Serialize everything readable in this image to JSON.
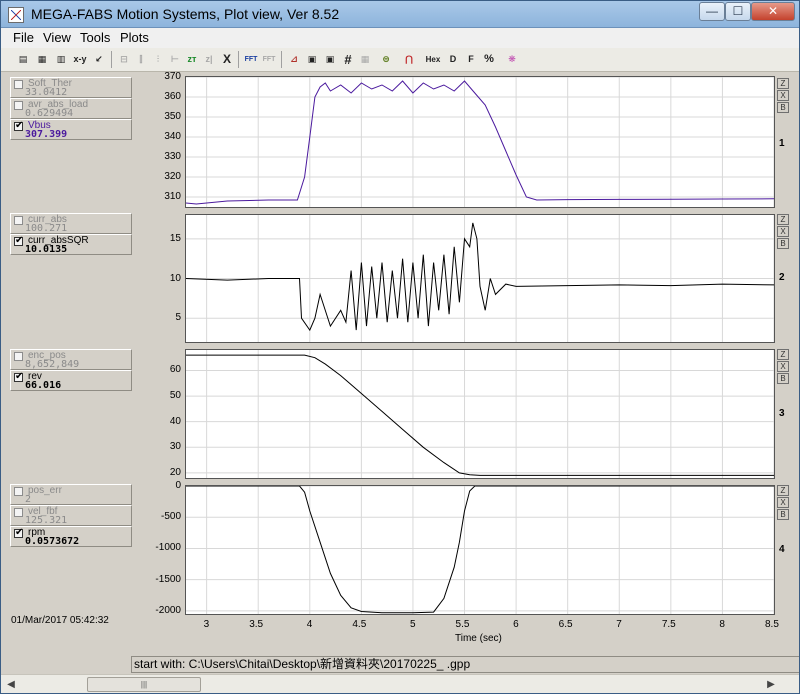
{
  "window": {
    "title": "MEGA-FABS Motion Systems, Plot view, Ver 8.52",
    "controls": {
      "minimize": "—",
      "maximize": "☐",
      "close": "✕"
    }
  },
  "menu": {
    "items": [
      "File",
      "View",
      "Tools",
      "Plots"
    ]
  },
  "toolbar": {
    "buttons": [
      "▤",
      "▦",
      "▥",
      "x-y",
      "↙",
      "⊟",
      "⫿",
      "⫶",
      "⊢",
      "zт",
      "z|",
      "X",
      "FFT",
      "FFT",
      "⊿",
      "▣",
      "▣",
      "#",
      "▦",
      "⊜",
      "⋂",
      "Hex",
      "D",
      "F",
      "%",
      "❋"
    ]
  },
  "channels": {
    "panel1": [
      {
        "name": "Soft_Ther",
        "value": "33.0412",
        "checked": false
      },
      {
        "name": "avr_abs_load",
        "value": "0.629494",
        "checked": false
      },
      {
        "name": "Vbus",
        "value": "307.399",
        "checked": true
      }
    ],
    "panel2": [
      {
        "name": "curr_abs",
        "value": "100.271",
        "checked": false
      },
      {
        "name": "curr_absSQR",
        "value": "10.0135",
        "checked": true
      }
    ],
    "panel3": [
      {
        "name": "enc_pos",
        "value": "8,652,849",
        "checked": false
      },
      {
        "name": "rev",
        "value": "66.016",
        "checked": true
      }
    ],
    "panel4": [
      {
        "name": "pos_err",
        "value": "2",
        "checked": false
      },
      {
        "name": "vel_fbf",
        "value": "125.321",
        "checked": false
      },
      {
        "name": "rpm",
        "value": "0.0573672",
        "checked": true
      }
    ]
  },
  "datetime": "01/Mar/2017  05:42:32",
  "plot_numbers": [
    "1",
    "2",
    "3",
    "4"
  ],
  "side_buttons": [
    "Z",
    "X",
    "B"
  ],
  "status": {
    "text": "start with: C:\\Users\\Chitai\\Desktop\\新增資料夾\\20170225_        .gpp"
  },
  "scroll": {
    "left": "◀",
    "right": "▶",
    "grip": "|||"
  },
  "chart_data": [
    {
      "type": "line",
      "title": "",
      "xlabel": "Time (sec)",
      "ylabel": "",
      "xlim": [
        2.8,
        8.5
      ],
      "ylim": [
        305,
        370
      ],
      "ytick_labels": [
        "370",
        "360",
        "350",
        "340",
        "330",
        "320",
        "310"
      ],
      "x_tick_labels": [
        "3",
        "3.5",
        "4",
        "4.5",
        "5",
        "5.5",
        "6",
        "6.5",
        "7",
        "7.5",
        "8",
        "8.5"
      ],
      "series": [
        {
          "name": "Vbus",
          "color": "#4b1a9e",
          "x": [
            2.8,
            2.9,
            3.2,
            3.6,
            3.88,
            3.95,
            4.0,
            4.05,
            4.1,
            4.15,
            4.2,
            4.3,
            4.4,
            4.5,
            4.6,
            4.7,
            4.8,
            4.9,
            5.0,
            5.1,
            5.2,
            5.3,
            5.4,
            5.5,
            5.6,
            5.7,
            5.8,
            5.9,
            6.0,
            6.1,
            6.2,
            6.5,
            7.0,
            7.5,
            8.0,
            8.5
          ],
          "y": [
            307,
            306.5,
            308,
            308.5,
            308.5,
            320,
            340,
            360,
            365,
            367,
            363,
            366,
            362,
            367,
            364,
            366,
            363,
            368,
            362,
            367,
            364,
            366,
            363,
            368,
            362,
            356,
            345,
            333,
            321,
            310,
            308.5,
            308.7,
            308.8,
            308.9,
            309,
            309.1
          ]
        }
      ]
    },
    {
      "type": "line",
      "title": "",
      "xlabel": "Time (sec)",
      "ylabel": "",
      "xlim": [
        2.8,
        8.5
      ],
      "ylim": [
        2,
        18
      ],
      "ytick_labels": [
        "15",
        "10",
        "5"
      ],
      "x_tick_labels": [
        "3",
        "3.5",
        "4",
        "4.5",
        "5",
        "5.5",
        "6",
        "6.5",
        "7",
        "7.5",
        "8",
        "8.5"
      ],
      "series": [
        {
          "name": "curr_absSQR",
          "color": "#000000",
          "x": [
            2.8,
            3.2,
            3.6,
            3.9,
            3.92,
            4.0,
            4.05,
            4.1,
            4.2,
            4.3,
            4.35,
            4.4,
            4.45,
            4.5,
            4.55,
            4.6,
            4.65,
            4.7,
            4.75,
            4.8,
            4.85,
            4.9,
            4.95,
            5.0,
            5.05,
            5.1,
            5.15,
            5.2,
            5.25,
            5.3,
            5.35,
            5.4,
            5.45,
            5.5,
            5.55,
            5.58,
            5.62,
            5.65,
            5.7,
            5.75,
            5.8,
            5.9,
            6.0,
            6.5,
            7.0,
            7.5,
            8.0,
            8.5
          ],
          "y": [
            10,
            9.8,
            10,
            10,
            5,
            3.5,
            5,
            8,
            4,
            6,
            4.5,
            11,
            3.5,
            12,
            4,
            11.5,
            5,
            12,
            4.5,
            11,
            5,
            12.5,
            4.5,
            12,
            5,
            13,
            4,
            12,
            6,
            13,
            5.5,
            14,
            7,
            15,
            14,
            17,
            15,
            9,
            6,
            10,
            8,
            9.3,
            9,
            9.1,
            9.2,
            9.1,
            9.3,
            9.2
          ]
        }
      ]
    },
    {
      "type": "line",
      "title": "",
      "xlabel": "Time (sec)",
      "ylabel": "",
      "xlim": [
        2.8,
        8.5
      ],
      "ylim": [
        18,
        68
      ],
      "ytick_labels": [
        "60",
        "50",
        "40",
        "30",
        "20"
      ],
      "x_tick_labels": [
        "3",
        "3.5",
        "4",
        "4.5",
        "5",
        "5.5",
        "6",
        "6.5",
        "7",
        "7.5",
        "8",
        "8.5"
      ],
      "series": [
        {
          "name": "rev",
          "color": "#000000",
          "x": [
            2.8,
            3.5,
            3.95,
            4.05,
            4.15,
            4.3,
            4.5,
            4.7,
            4.9,
            5.1,
            5.3,
            5.45,
            5.55,
            5.65,
            6.0,
            7.0,
            8.5
          ],
          "y": [
            66,
            66,
            66,
            65,
            62.5,
            58,
            51,
            44,
            37,
            30,
            24,
            20,
            19.3,
            19,
            19,
            19,
            19
          ]
        }
      ]
    },
    {
      "type": "line",
      "title": "",
      "xlabel": "Time (sec)",
      "ylabel": "",
      "xlim": [
        2.8,
        8.5
      ],
      "ylim": [
        -2050,
        0
      ],
      "ytick_labels": [
        "0",
        "-500",
        "-1000",
        "-1500",
        "-2000"
      ],
      "x_tick_labels": [
        "3",
        "3.5",
        "4",
        "4.5",
        "5",
        "5.5",
        "6",
        "6.5",
        "7",
        "7.5",
        "8",
        "8.5"
      ],
      "series": [
        {
          "name": "rpm",
          "color": "#000000",
          "x": [
            2.8,
            3.5,
            3.9,
            3.95,
            4.0,
            4.1,
            4.2,
            4.3,
            4.4,
            4.5,
            4.7,
            5.0,
            5.2,
            5.3,
            5.4,
            5.45,
            5.5,
            5.55,
            5.6,
            6.0,
            8.5
          ],
          "y": [
            0,
            0,
            0,
            -100,
            -400,
            -900,
            -1400,
            -1750,
            -1950,
            -2010,
            -2030,
            -2030,
            -2020,
            -1800,
            -1300,
            -900,
            -400,
            -80,
            0,
            0,
            0
          ]
        }
      ]
    }
  ]
}
